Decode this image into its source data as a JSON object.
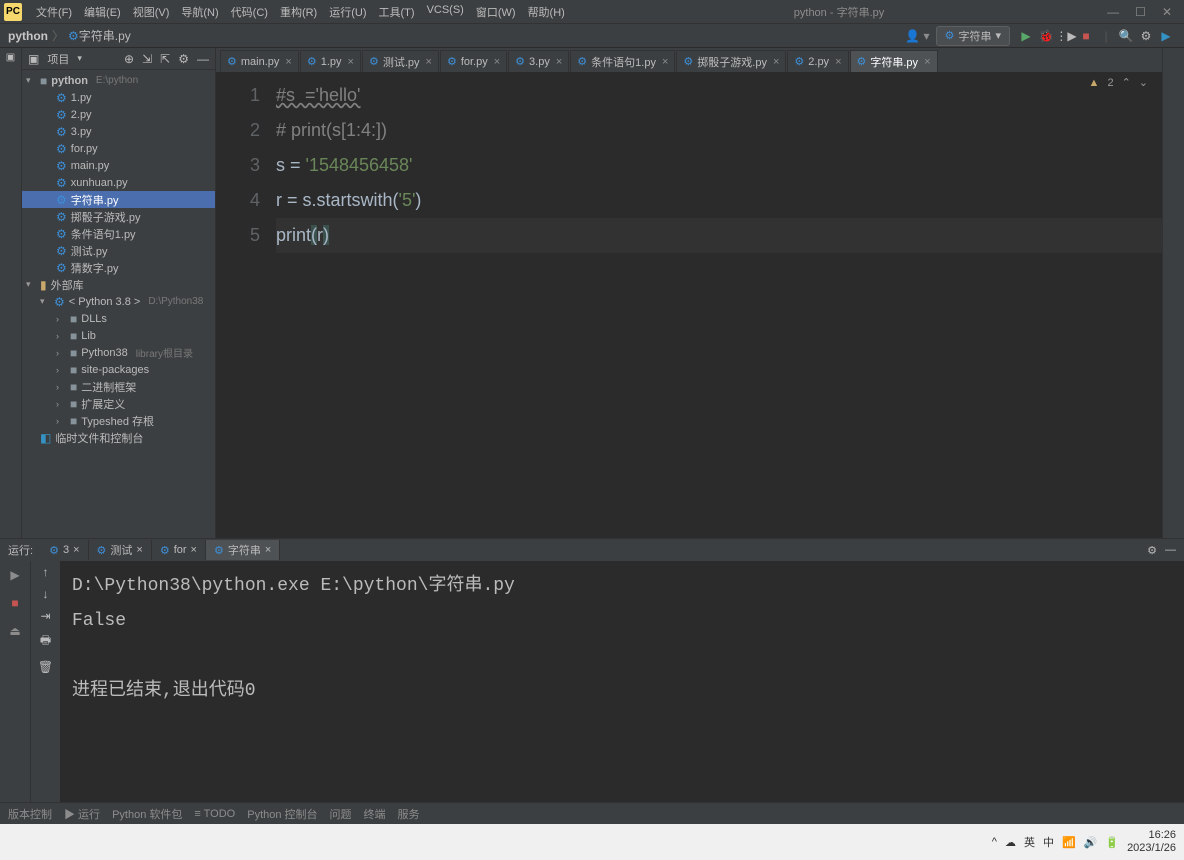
{
  "window": {
    "title": "python - 字符串.py",
    "logo": "PC"
  },
  "menu": [
    "文件(F)",
    "编辑(E)",
    "视图(V)",
    "导航(N)",
    "代码(C)",
    "重构(R)",
    "运行(U)",
    "工具(T)",
    "VCS(S)",
    "窗口(W)",
    "帮助(H)"
  ],
  "breadcrumb": {
    "project": "python",
    "file": "字符串.py"
  },
  "run_config": "字符串",
  "sidebar": {
    "title": "项目",
    "root": {
      "name": "python",
      "path": "E:\\python"
    },
    "files": [
      "1.py",
      "2.py",
      "3.py",
      "for.py",
      "main.py",
      "xunhuan.py",
      "字符串.py",
      "掷骰子游戏.py",
      "条件语句1.py",
      "测试.py",
      "猜数字.py"
    ],
    "selected": "字符串.py",
    "external": "外部库",
    "python_env": "< Python 3.8 >",
    "python_path": "D:\\Python38",
    "libs": [
      "DLLs",
      "Lib",
      "Python38",
      "site-packages",
      "二进制框架",
      "扩展定义",
      "Typeshed 存根"
    ],
    "lib_hint": "library根目录",
    "scratch": "临时文件和控制台"
  },
  "editor_tabs": [
    "main.py",
    "1.py",
    "测试.py",
    "for.py",
    "3.py",
    "条件语句1.py",
    "掷骰子游戏.py",
    "2.py",
    "字符串.py"
  ],
  "active_tab": "字符串.py",
  "warnings": "2",
  "code": {
    "lines": [
      {
        "n": "1",
        "tokens": [
          {
            "t": "#s  ='hello'",
            "c": "comment squiggle"
          }
        ]
      },
      {
        "n": "2",
        "tokens": [
          {
            "t": "# print(s[1:4:])",
            "c": "comment"
          }
        ]
      },
      {
        "n": "3",
        "tokens": [
          {
            "t": "s = ",
            "c": ""
          },
          {
            "t": "'1548456458'",
            "c": "string"
          }
        ]
      },
      {
        "n": "4",
        "tokens": [
          {
            "t": "r = s.startswith(",
            "c": ""
          },
          {
            "t": "'5'",
            "c": "string"
          },
          {
            "t": ")",
            "c": ""
          }
        ]
      },
      {
        "n": "5",
        "tokens": [
          {
            "t": "print",
            "c": "func"
          },
          {
            "t": "(",
            "c": "paren-hl"
          },
          {
            "t": "r",
            "c": ""
          },
          {
            "t": ")",
            "c": "paren-hl"
          }
        ]
      }
    ]
  },
  "run": {
    "label": "运行:",
    "tabs": [
      "3",
      "测试",
      "for",
      "字符串"
    ],
    "active": "字符串",
    "output": "D:\\Python38\\python.exe E:\\python\\字符串.py\nFalse\n\n进程已结束,退出代码0"
  },
  "bottom": [
    "版本控制",
    "▶ 运行",
    "Python 软件包",
    "≡ TODO",
    "Python 控制台",
    "问题",
    "终端",
    "服务"
  ],
  "taskbar": {
    "lang": "英",
    "ime": "中",
    "time": "16:26",
    "date": "2023/1/26"
  }
}
